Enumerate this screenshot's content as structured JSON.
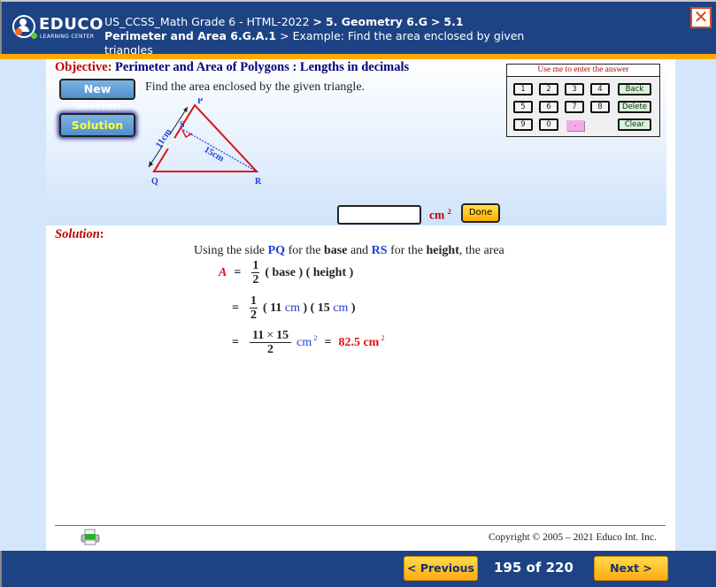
{
  "header": {
    "logo": {
      "word": "EDUCO",
      "sub": "LEARNING CENTER"
    },
    "breadcrumb": {
      "course": "US_CCSS_Math Grade 6 - HTML-2022",
      "sep": ">",
      "chapter": "5. Geometry 6.G",
      "section": "5.1 Perimeter and Area 6.G.A.1",
      "page": "Example: Find the area enclosed by given triangles"
    },
    "close_icon": "✕"
  },
  "problem": {
    "objective_label": "Objective:",
    "objective_text": "Perimeter and Area of Polygons : Lengths in decimals",
    "new_version_label": "New Version",
    "solution_button_label": "Solution",
    "question": "Find the area enclosed by the given triangle.",
    "diagram": {
      "vertices": {
        "P": "P",
        "Q": "Q",
        "R": "R",
        "S": "S"
      },
      "side_label": "11cm",
      "height_label": "15cm",
      "colors": {
        "triangle": "#e01010",
        "labels": "#1f3fd6",
        "height_line": "#1f3fd6"
      }
    },
    "keypad": {
      "title": "Use me to enter the answer",
      "digits": [
        "1",
        "2",
        "3",
        "4",
        "5",
        "6",
        "7",
        "8",
        "9",
        "0"
      ],
      "dot": ".",
      "back": "Back",
      "delete": "Delete",
      "clear": "Clear"
    },
    "answer": {
      "value": "",
      "unit": "cm",
      "unit_power": "2",
      "done_label": "Done"
    }
  },
  "solution": {
    "heading": "Solution",
    "heading_colon": ":",
    "intro": {
      "t1": "Using the side ",
      "pq": "PQ",
      "t2": " for the ",
      "base": "base",
      "t3": " and ",
      "rs": "RS",
      "t4": " for the ",
      "height": "height",
      "t5": ", the area"
    },
    "line1": {
      "lhs": "A",
      "eq": "=",
      "num": "1",
      "den": "2",
      "rest": "( base ) ( height )"
    },
    "line2": {
      "eq": "=",
      "num": "1",
      "den": "2",
      "p1": "( 11 ",
      "u1": "cm",
      "p2": " ) ( 15 ",
      "u2": "cm",
      "p3": " )"
    },
    "line3": {
      "eq": "=",
      "num_a": "11",
      "times": "×",
      "num_b": "15",
      "den": "2",
      "unit": "cm",
      "power": "2",
      "eq2": "=",
      "result": "82.5 cm",
      "result_power": "2"
    }
  },
  "footer": {
    "copyright": "Copyright © 2005 – 2021 Educo Int. Inc.",
    "previous_label": "< Previous",
    "next_label": "Next >",
    "page_current": "195",
    "page_of": "of",
    "page_total": "220"
  },
  "colors": {
    "header_bg": "#1e4384",
    "accent_orange": "#ffa800",
    "objective_red": "#c00000",
    "objective_blue": "#00007a",
    "highlight_blue": "#1f3fd6",
    "answer_red": "#e01010"
  }
}
